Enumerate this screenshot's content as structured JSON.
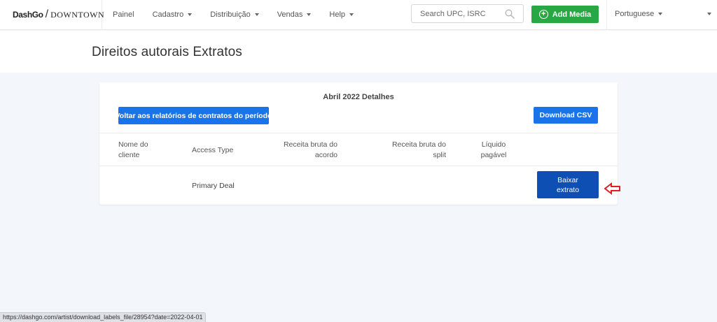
{
  "header": {
    "logo_brand": "DashGo",
    "logo_slash": "/",
    "logo_product": "DOWNTOWN",
    "nav": [
      {
        "label": "Painel",
        "has_dropdown": false
      },
      {
        "label": "Cadastro",
        "has_dropdown": true
      },
      {
        "label": "Distribuição",
        "has_dropdown": true
      },
      {
        "label": "Vendas",
        "has_dropdown": true
      },
      {
        "label": "Help",
        "has_dropdown": true
      }
    ],
    "search_placeholder": "Search UPC, ISRC",
    "add_media_label": "Add Media",
    "language": "Portuguese"
  },
  "page": {
    "title": "Direitos autorais Extratos"
  },
  "card": {
    "title": "Abril 2022 Detalhes",
    "back_button": "Voltar aos relatórios de contratos do período",
    "csv_button": "Download CSV",
    "columns": {
      "client_line1": "Nome do",
      "client_line2": "cliente",
      "access_type": "Access Type",
      "gross_agreement_line1": "Receita bruta do",
      "gross_agreement_line2": "acordo",
      "gross_split_line1": "Receita bruta do",
      "gross_split_line2": "split",
      "net_line1": "Líquido",
      "net_line2": "pagável"
    },
    "rows": [
      {
        "client": "",
        "access_type": "Primary Deal",
        "gross_agreement": "",
        "gross_split": "",
        "net": "",
        "action": "Baixar extrato"
      }
    ]
  },
  "status_bar": {
    "url": "https://dashgo.com/artist/download_labels_file/28954?date=2022-04-01"
  },
  "colors": {
    "primary_blue": "#1a73e8",
    "dark_blue": "#0d4fb3",
    "green": "#28a745",
    "arrow_red": "#e11d2a",
    "background": "#f3f6fa"
  },
  "icons": {
    "search": "search-icon",
    "add": "plus-circle-icon",
    "dropdown": "caret-down-icon",
    "annotation": "arrow-left-icon"
  }
}
